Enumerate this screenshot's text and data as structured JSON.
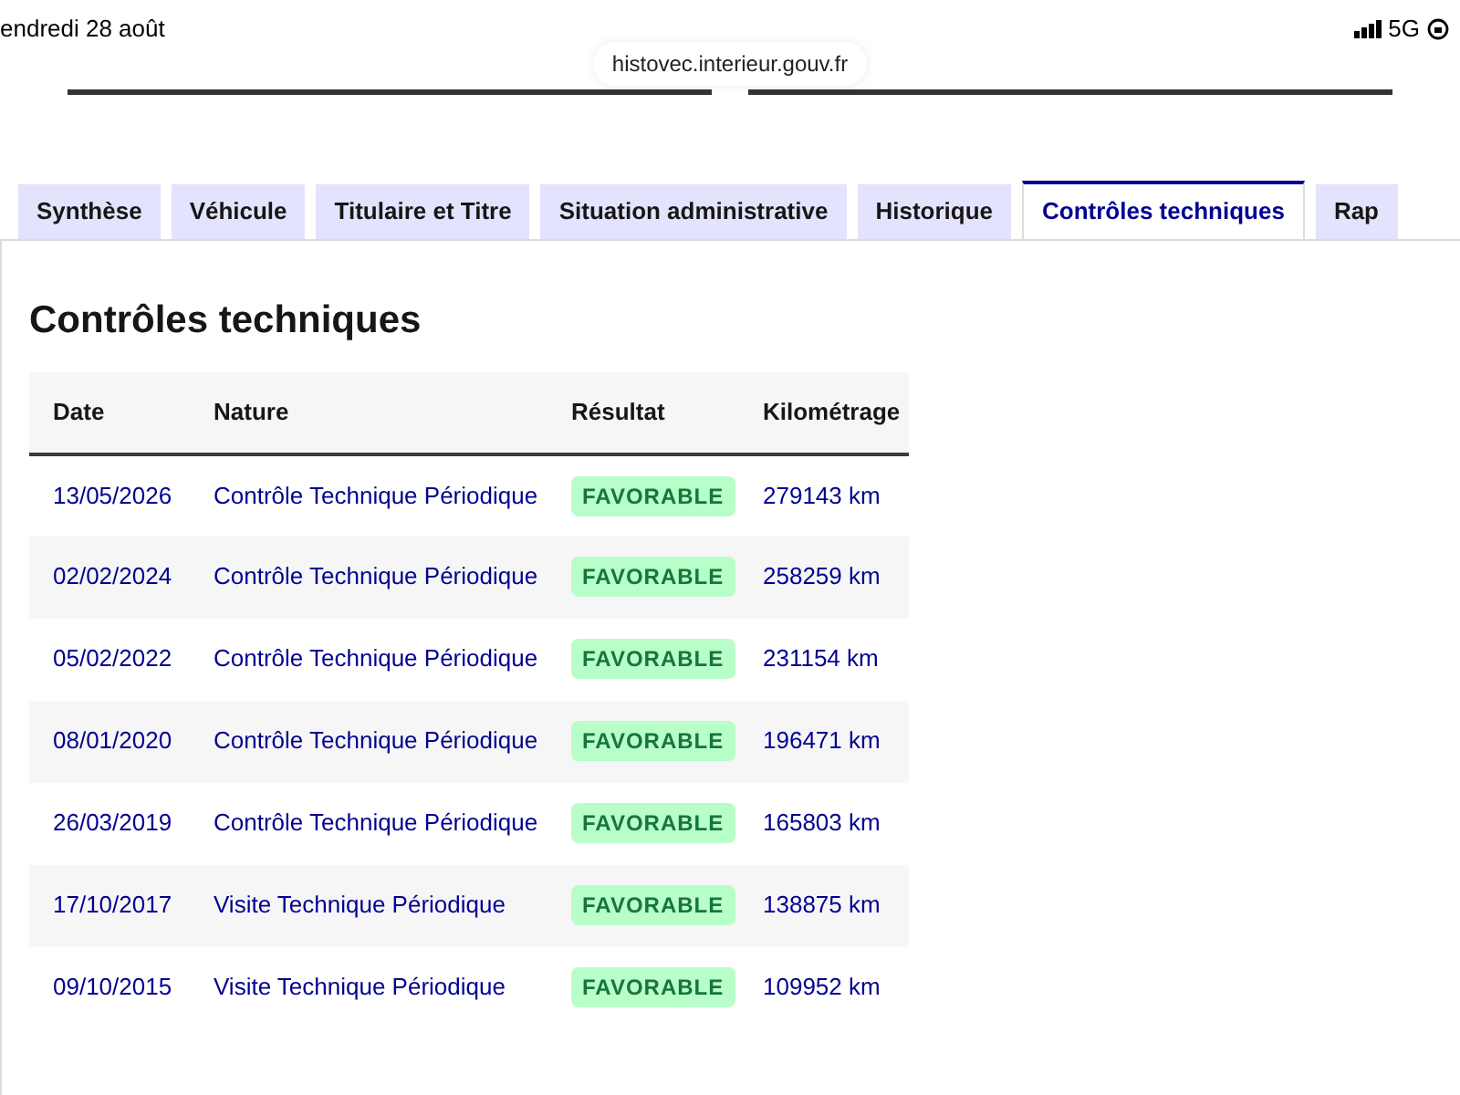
{
  "status_bar": {
    "date": "endredi 28 août",
    "network": "5G"
  },
  "address_bar": {
    "url": "histovec.interieur.gouv.fr"
  },
  "tabs": [
    {
      "label": "Synthèse",
      "selected": false
    },
    {
      "label": "Véhicule",
      "selected": false
    },
    {
      "label": "Titulaire et Titre",
      "selected": false
    },
    {
      "label": "Situation administrative",
      "selected": false
    },
    {
      "label": "Historique",
      "selected": false
    },
    {
      "label": "Contrôles techniques",
      "selected": true
    },
    {
      "label": "Rap",
      "selected": false
    }
  ],
  "section": {
    "title": "Contrôles techniques"
  },
  "table": {
    "columns": [
      "Date",
      "Nature",
      "Résultat",
      "Kilométrage"
    ],
    "rows": [
      {
        "date": "13/05/2026",
        "nature": "Contrôle Technique Périodique",
        "result": "FAVORABLE",
        "mileage": "279143 km"
      },
      {
        "date": "02/02/2024",
        "nature": "Contrôle Technique Périodique",
        "result": "FAVORABLE",
        "mileage": "258259 km"
      },
      {
        "date": "05/02/2022",
        "nature": "Contrôle Technique Périodique",
        "result": "FAVORABLE",
        "mileage": "231154 km"
      },
      {
        "date": "08/01/2020",
        "nature": "Contrôle Technique Périodique",
        "result": "FAVORABLE",
        "mileage": "196471 km"
      },
      {
        "date": "26/03/2019",
        "nature": "Contrôle Technique Périodique",
        "result": "FAVORABLE",
        "mileage": "165803 km"
      },
      {
        "date": "17/10/2017",
        "nature": "Visite Technique Périodique",
        "result": "FAVORABLE",
        "mileage": "138875 km"
      },
      {
        "date": "09/10/2015",
        "nature": "Visite Technique Périodique",
        "result": "FAVORABLE",
        "mileage": "109952 km"
      }
    ]
  }
}
